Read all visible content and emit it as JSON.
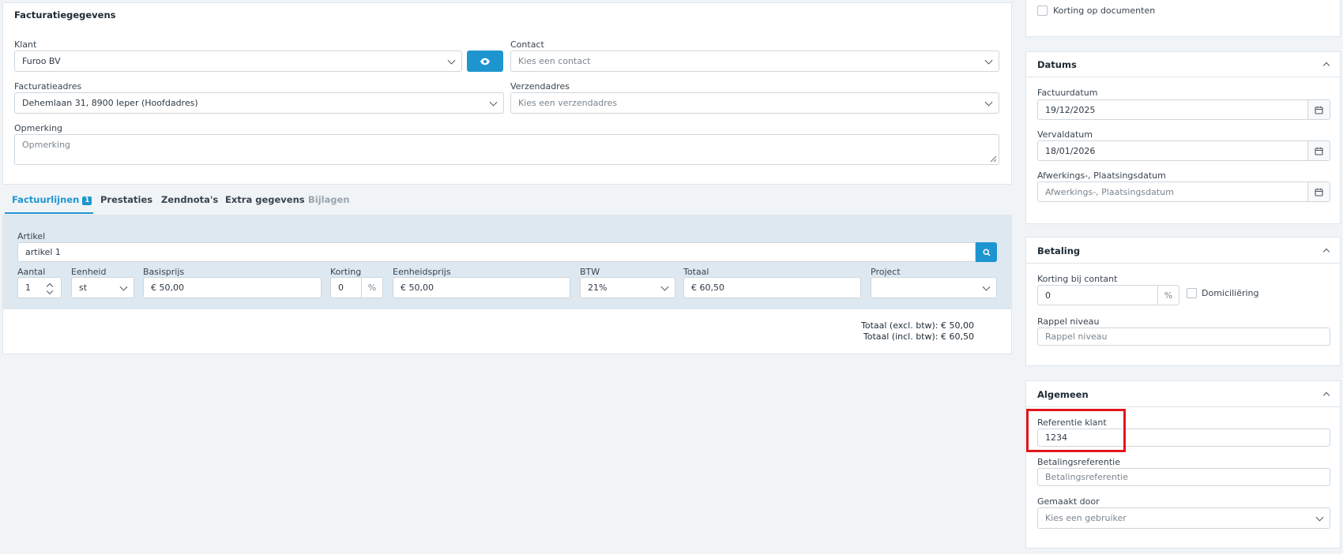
{
  "billing": {
    "title": "Facturatiegegevens",
    "client_label": "Klant",
    "client_value": "Furoo BV",
    "contact_label": "Contact",
    "contact_placeholder": "Kies een contact",
    "billing_address_label": "Facturatieadres",
    "billing_address_value": "Dehemlaan 31, 8900 Ieper (Hoofdadres)",
    "shipping_address_label": "Verzendadres",
    "shipping_address_placeholder": "Kies een verzendadres",
    "remark_label": "Opmerking",
    "remark_placeholder": "Opmerking"
  },
  "tabs": [
    {
      "label": "Factuurlijnen",
      "badge": "1",
      "state": "active"
    },
    {
      "label": "Prestaties",
      "state": "normal"
    },
    {
      "label": "Zendnota's",
      "state": "normal"
    },
    {
      "label": "Extra gegevens",
      "state": "normal"
    },
    {
      "label": "Bijlagen",
      "state": "disabled"
    }
  ],
  "line": {
    "article_label": "Artikel",
    "article_value": "artikel 1",
    "quantity_label": "Aantal",
    "quantity_value": "1",
    "unit_label": "Eenheid",
    "unit_value": "st",
    "base_price_label": "Basisprijs",
    "base_price_value": "€ 50,00",
    "discount_label": "Korting",
    "discount_value": "0",
    "discount_suffix": "%",
    "unit_price_label": "Eenheidsprijs",
    "unit_price_value": "€ 50,00",
    "vat_label": "BTW",
    "vat_value": "21%",
    "total_label": "Totaal",
    "total_value": "€ 60,50",
    "project_label": "Project",
    "project_value": ""
  },
  "totals": {
    "excl_label": "Totaal (excl. btw):",
    "excl_value": "€ 50,00",
    "incl_label": "Totaal (incl. btw):",
    "incl_value": "€ 60,50"
  },
  "sidebar": {
    "discount_docs_label": "Korting op documenten",
    "dates": {
      "title": "Datums",
      "invoice_date_label": "Factuurdatum",
      "invoice_date_value": "19/12/2025",
      "due_date_label": "Vervaldatum",
      "due_date_value": "18/01/2026",
      "completion_label": "Afwerkings-, Plaatsingsdatum",
      "completion_placeholder": "Afwerkings-, Plaatsingsdatum"
    },
    "payment": {
      "title": "Betaling",
      "cash_discount_label": "Korting bij contant",
      "cash_discount_value": "0",
      "cash_discount_suffix": "%",
      "direct_debit_label": "Domiciliëring",
      "reminder_label": "Rappel niveau",
      "reminder_placeholder": "Rappel niveau"
    },
    "general": {
      "title": "Algemeen",
      "client_ref_label": "Referentie klant",
      "client_ref_value": "1234",
      "payment_ref_label": "Betalingsreferentie",
      "payment_ref_placeholder": "Betalingsreferentie",
      "created_by_label": "Gemaakt door",
      "created_by_placeholder": "Kies een gebruiker"
    }
  },
  "colors": {
    "accent": "#1f95d0",
    "highlight": "#e2161c",
    "line_bg": "#dde8f1",
    "page_bg": "#f0f4f7"
  },
  "icons": {
    "view_client": "eye-icon",
    "article_search": "search-icon",
    "date_picker": "calendar-icon",
    "select": "chevron-down-icon",
    "collapse": "chevron-up-icon",
    "resize": "resize-handle-icon"
  }
}
